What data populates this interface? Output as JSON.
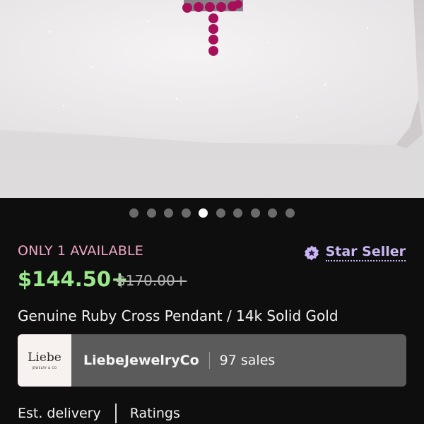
{
  "colors": {
    "availability": "#f0a6c8",
    "price": "#9be88a",
    "star_seller": "#c9b6f2",
    "shop_card": "#5b5b5b",
    "background": "#0e0e0e"
  },
  "gallery": {
    "image_label": "Ruby cross pendant on white crystal",
    "image_count": 10,
    "active_index": 4
  },
  "listing": {
    "availability": "ONLY 1 AVAILABLE",
    "star_seller_label": "Star Seller",
    "star_seller_icon": "star-seller-badge-icon",
    "price": "$144.50+",
    "original_price": "$170.00+",
    "title": "Genuine Ruby Cross Pendant / 14k Solid Gold"
  },
  "shop": {
    "logo_text": "Liebe",
    "logo_subtext": "JEWELRY & CO",
    "name": "LiebeJewelryCo",
    "sales": "97 sales"
  },
  "bottom_tabs": {
    "delivery": "Est. delivery",
    "ratings": "Ratings"
  }
}
